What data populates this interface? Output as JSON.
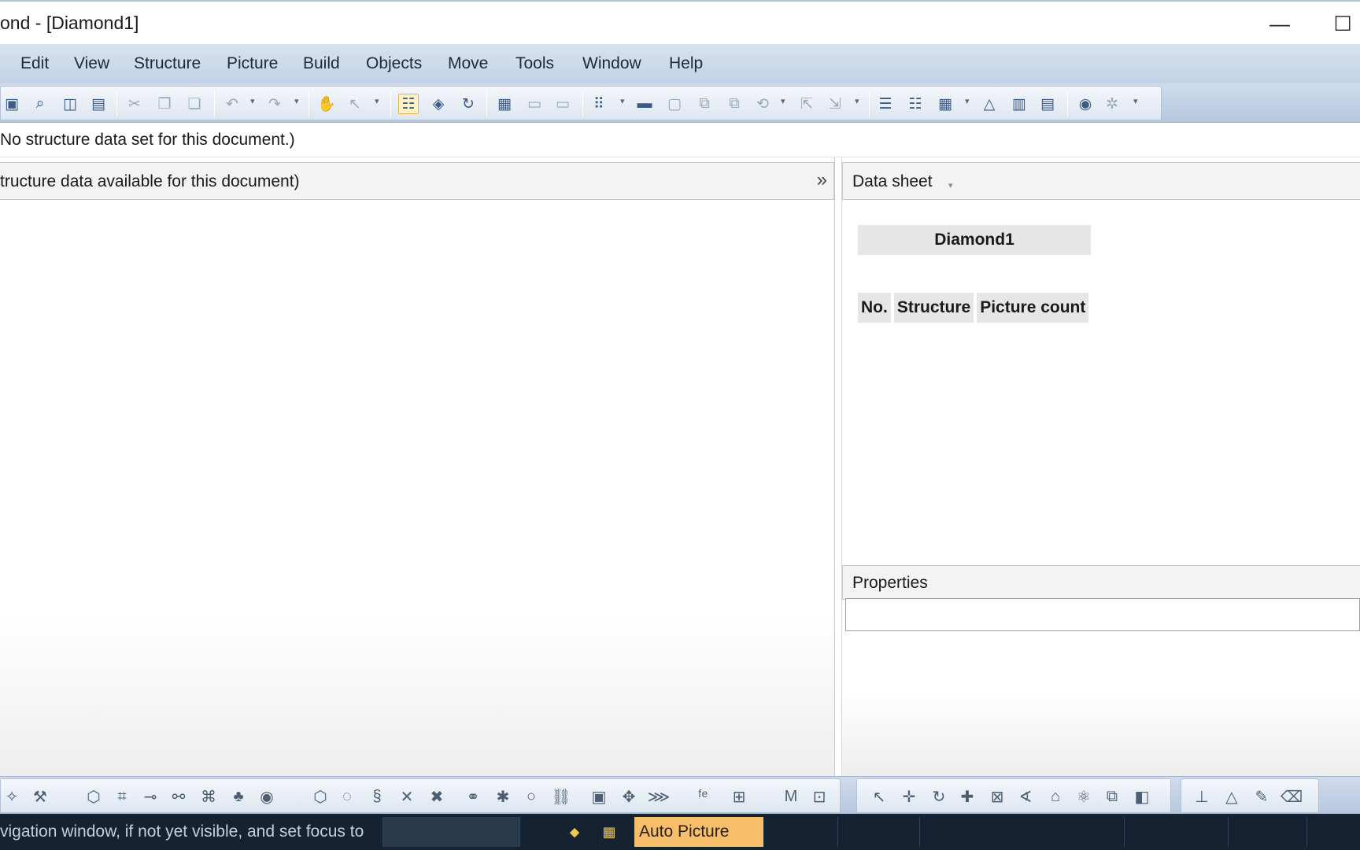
{
  "window": {
    "title": "ond - [Diamond1]",
    "minimize_glyph": "—",
    "maximize_glyph": "☐"
  },
  "menu": [
    "Edit",
    "View",
    "Structure",
    "Picture",
    "Build",
    "Objects",
    "Move",
    "Tools",
    "Window",
    "Help"
  ],
  "toolbar": {
    "icons": [
      "save-icon",
      "find-icon",
      "print-preview-icon",
      "print-icon",
      "cut-icon",
      "copy-icon",
      "paste-icon",
      "undo-icon",
      "redo-icon",
      "pan-hand-icon",
      "select-pointer-icon",
      "data-sheet-icon",
      "auto-picture-icon",
      "refresh-icon",
      "new-picture-icon",
      "picture-copy-icon",
      "picture-dim-icon",
      "grid-icon",
      "camera-icon",
      "new-page-icon",
      "copy-page-icon",
      "paste-page-icon",
      "rotate-icon",
      "export-icon",
      "import-icon",
      "list-icon",
      "list-details-icon",
      "table-icon",
      "triangle-icon",
      "chart-icon",
      "table-data-icon",
      "diamond-icon",
      "tool-icon"
    ]
  },
  "status_line": "No structure data set for this document.)",
  "left_panel": {
    "header": "tructure data available for this document)",
    "collapse_glyph": "»"
  },
  "data_sheet": {
    "tab_label": "Data sheet",
    "title": "Diamond1",
    "columns": [
      "No.",
      "Structure",
      "Picture count"
    ]
  },
  "properties": {
    "header": "Properties",
    "value": ""
  },
  "bottom_toolbar": {
    "icons": [
      "magic-wand-icon",
      "pick-icon",
      "polyhedron-icon",
      "lattice-icon",
      "bond-icon",
      "molecule-icon",
      "cluster-icon",
      "tree-icon",
      "sphere-icon",
      "hexagon-icon",
      "ring-icon",
      "coil-icon",
      "cross-icon",
      "cross-alt-icon",
      "link-icon",
      "network-icon",
      "ellipse-icon",
      "chain-icon",
      "frame-icon",
      "move-4way-icon",
      "lattice-plane-icon",
      "fe-label-icon",
      "grid-points-icon",
      "m-label-icon",
      "box-select-icon",
      "pointer-icon",
      "move-icon",
      "rotate-icon",
      "translate-icon",
      "zoom-box-icon",
      "angle-icon",
      "pyramid-icon",
      "atoms-icon",
      "object-icon",
      "layers-icon",
      "ruler-icon",
      "measure-angle-icon",
      "measure-icon",
      "eraser-icon"
    ]
  },
  "statusbar": {
    "message": "vigation window, if not yet visible, and set focus to",
    "mode": "Auto Picture"
  }
}
